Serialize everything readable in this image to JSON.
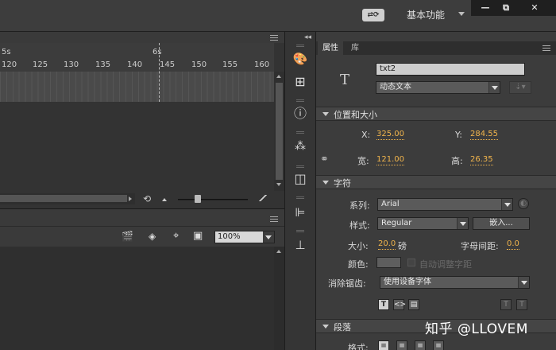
{
  "topbar": {
    "sync_icon": "sync-settings-icon",
    "workspace": "基本功能",
    "window_buttons": [
      "—",
      "⧉",
      "✕"
    ]
  },
  "timeline": {
    "seconds": [
      "5s",
      "6s"
    ],
    "frames": [
      "120",
      "125",
      "130",
      "135",
      "140",
      "145",
      "150",
      "155",
      "160"
    ]
  },
  "stage": {
    "zoom": "100%"
  },
  "dock": {
    "icons": [
      "color-palette-icon",
      "swatches-grid-icon",
      "info-icon",
      "motion-presets-icon",
      "transform-icon",
      "align-icon",
      "components-icon"
    ]
  },
  "properties": {
    "tabs": [
      "属性",
      "库"
    ],
    "instance_name": "txt2",
    "text_type": "动态文本",
    "position_section": "位置和大小",
    "x_label": "X:",
    "x_value": "325.00",
    "y_label": "Y:",
    "y_value": "284.55",
    "width_label": "宽:",
    "width_value": "121.00",
    "height_label": "高:",
    "height_value": "26.35",
    "char_section": "字符",
    "family_label": "系列:",
    "family_value": "Arial",
    "style_label": "样式:",
    "style_value": "Regular",
    "embed_button": "嵌入...",
    "size_label": "大小:",
    "size_value": "20.0",
    "size_unit": "磅",
    "spacing_label": "字母间距:",
    "spacing_value": "0.0",
    "color_label": "颜色:",
    "auto_kern": "自动调整字距",
    "aa_label": "消除锯齿:",
    "aa_value": "使用设备字体",
    "para_section": "段落",
    "format_label": "格式:"
  },
  "watermark": "知乎 @LLOVEM",
  "colors": {
    "accent_value": "#f0b44c",
    "panel_bg": "#3c3c3c"
  }
}
